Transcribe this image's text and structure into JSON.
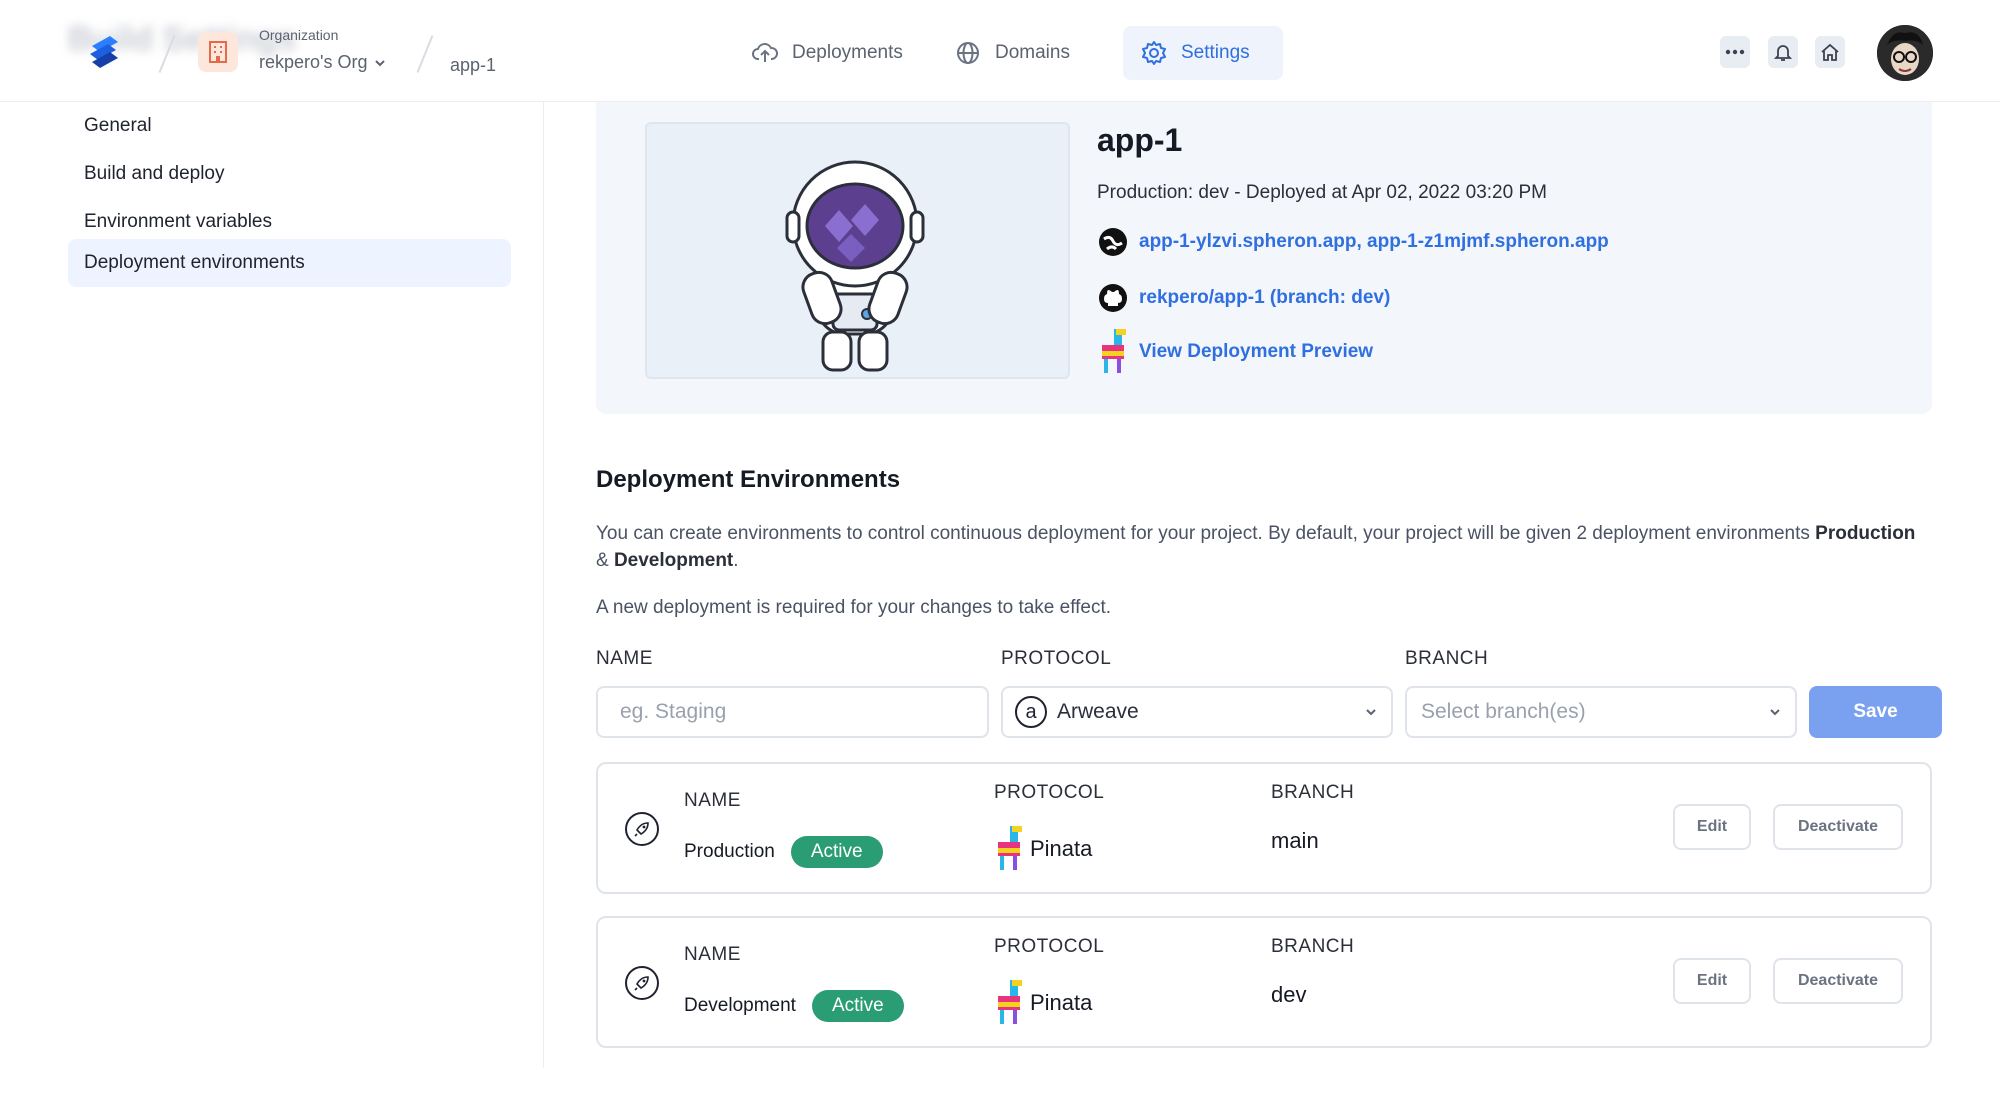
{
  "header": {
    "blurred_title": "Build Settings",
    "org_caption": "Organization",
    "org_name": "rekpero's Org",
    "project": "app-1",
    "nav": [
      {
        "label": "Deployments",
        "icon": "cloud-upload-icon"
      },
      {
        "label": "Domains",
        "icon": "globe-icon"
      },
      {
        "label": "Settings",
        "icon": "gear-icon"
      }
    ],
    "active_nav": "Settings"
  },
  "sidebar": {
    "items": [
      {
        "label": "General"
      },
      {
        "label": "Build and deploy"
      },
      {
        "label": "Environment variables"
      },
      {
        "label": "Deployment environments"
      }
    ],
    "active": "Deployment environments"
  },
  "project_card": {
    "title": "app-1",
    "meta": "Production: dev - Deployed at Apr 02, 2022 03:20 PM",
    "domains": "app-1-ylzvi.spheron.app, app-1-z1mjmf.spheron.app",
    "repo": "rekpero/app-1 (branch: dev)",
    "preview": "View Deployment Preview"
  },
  "environments": {
    "title": "Deployment Environments",
    "description_prefix": "You can create environments to control continuous deployment for your project. By default, your project will be given 2 deployment environments ",
    "production_word": "Production",
    "ampersand": " & ",
    "development_word": "Development",
    "period": ".",
    "note": "A new deployment is required for your changes to take effect.",
    "form": {
      "name_label": "NAME",
      "protocol_label": "PROTOCOL",
      "branch_label": "BRANCH",
      "name_placeholder": "eg. Staging",
      "protocol_value": "Arweave",
      "protocol_icon_letter": "a",
      "branch_placeholder": "Select branch(es)",
      "save_label": "Save"
    },
    "list": [
      {
        "name_header": "NAME",
        "name": "Production",
        "status": "Active",
        "protocol_header": "PROTOCOL",
        "protocol": "Pinata",
        "branch_header": "BRANCH",
        "branch": "main",
        "edit": "Edit",
        "deactivate": "Deactivate"
      },
      {
        "name_header": "NAME",
        "name": "Development",
        "status": "Active",
        "protocol_header": "PROTOCOL",
        "protocol": "Pinata",
        "branch_header": "BRANCH",
        "branch": "dev",
        "edit": "Edit",
        "deactivate": "Deactivate"
      }
    ]
  },
  "colors": {
    "accent": "#2f6fe0",
    "active_badge": "#2a9d74",
    "save_button": "#7aa1ef"
  }
}
